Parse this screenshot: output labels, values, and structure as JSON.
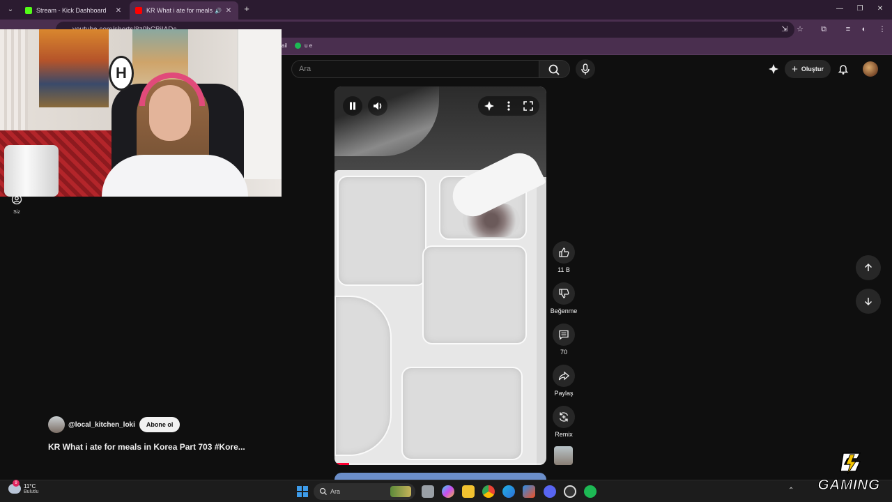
{
  "browser": {
    "tabs": [
      {
        "label": "Stream - Kick Dashboard",
        "favicon_color": "#53fc18"
      },
      {
        "label": "KR What i ate for meals in K",
        "favicon_color": "#ff0000"
      }
    ],
    "url": "youtube.com/shorts/8z0hCBjIADc",
    "bookmarks": [
      "ail",
      "u e"
    ]
  },
  "youtube": {
    "search_placeholder": "Ara",
    "create_label": "Oluştur",
    "sidebar_you_label": "Siz",
    "actions": {
      "like_count": "11 B",
      "dislike_label": "Beğenme",
      "comment_count": "70",
      "share_label": "Paylaş",
      "remix_label": "Remix"
    },
    "channel_handle": "@local_kitchen_loki",
    "subscribe_label": "Abone ol",
    "video_title": "KR What i ate for meals in Korea Part 703 #Kore...",
    "progress": 0.07
  },
  "taskbar": {
    "temperature": "11°C",
    "condition": "Bulutlu",
    "weather_badge": "9",
    "search_placeholder": "Ara"
  },
  "overlay": {
    "logo_text": "GAMING"
  },
  "colors": {
    "browser_frame": "#4a2f4f",
    "youtube_bg": "#0f0f0f",
    "progress_red": "#ff0033",
    "accent_start": "#3d9be9"
  }
}
